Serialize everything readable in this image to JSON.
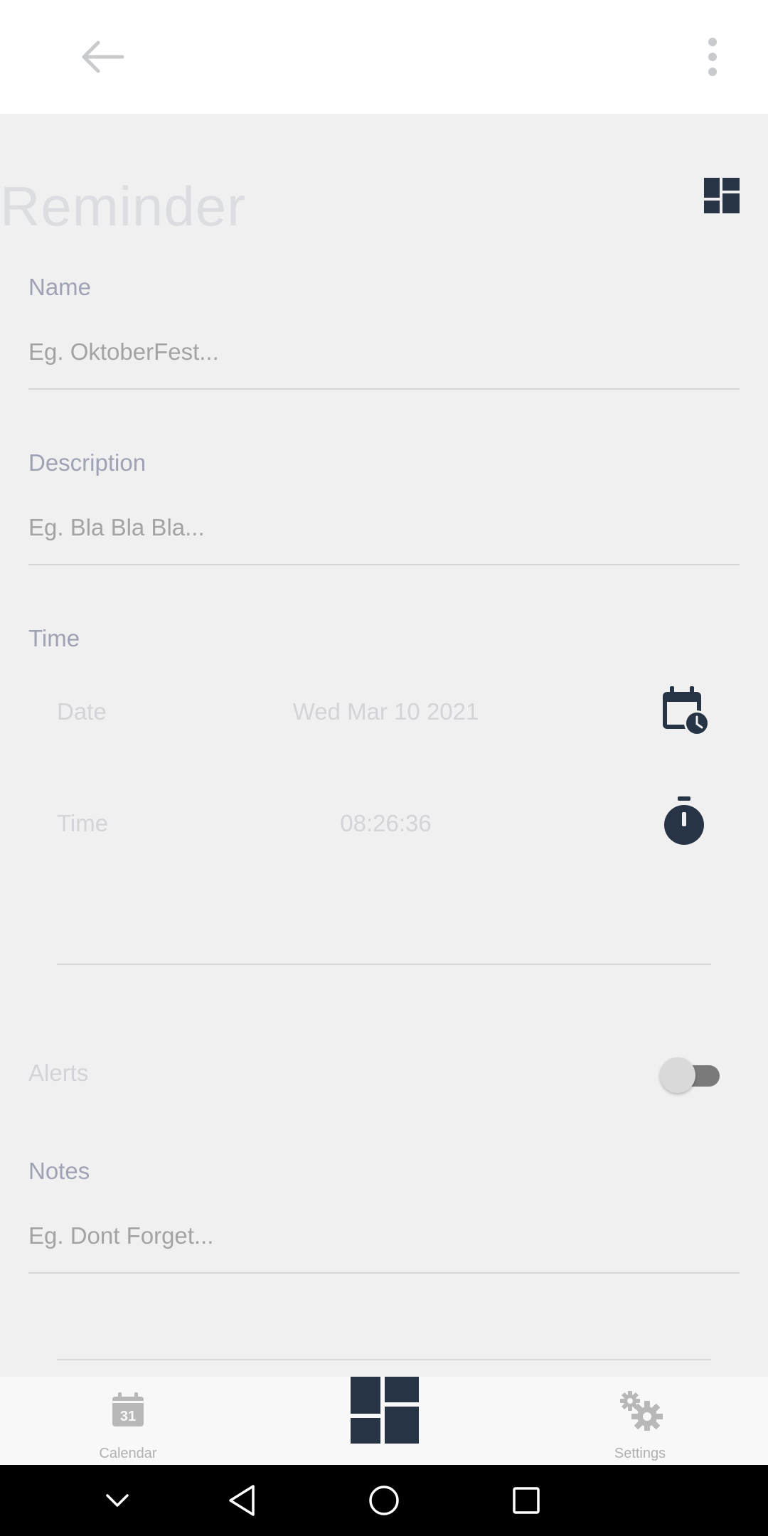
{
  "header": {
    "back_icon": "arrow-left-icon",
    "more_icon": "more-vertical-icon"
  },
  "page": {
    "title": "Reminder",
    "dashboard_icon": "dashboard-icon"
  },
  "form": {
    "name": {
      "label": "Name",
      "placeholder": "Eg. OktoberFest..."
    },
    "description": {
      "label": "Description",
      "placeholder": "Eg. Bla Bla Bla..."
    },
    "time": {
      "label": "Time",
      "date_label": "Date",
      "date_value": "Wed Mar 10 2021",
      "date_icon": "calendar-clock-icon",
      "time_label": "Time",
      "time_value": "08:26:36",
      "time_icon": "stopwatch-icon"
    },
    "alerts": {
      "label": "Alerts",
      "enabled": false
    },
    "notes": {
      "label": "Notes",
      "placeholder": "Eg. Dont Forget..."
    }
  },
  "bottom_nav": {
    "items": [
      {
        "label": "Calendar",
        "icon": "calendar-icon",
        "badge": "31"
      },
      {
        "label": "",
        "icon": "dashboard-icon"
      },
      {
        "label": "Settings",
        "icon": "gears-icon"
      }
    ]
  },
  "colors": {
    "accent": "#263446",
    "label": "#9fa1b4",
    "faded": "#d3d3d8"
  },
  "system_nav": [
    "chevron-down-icon",
    "back-triangle-icon",
    "home-circle-icon",
    "recents-square-icon"
  ]
}
